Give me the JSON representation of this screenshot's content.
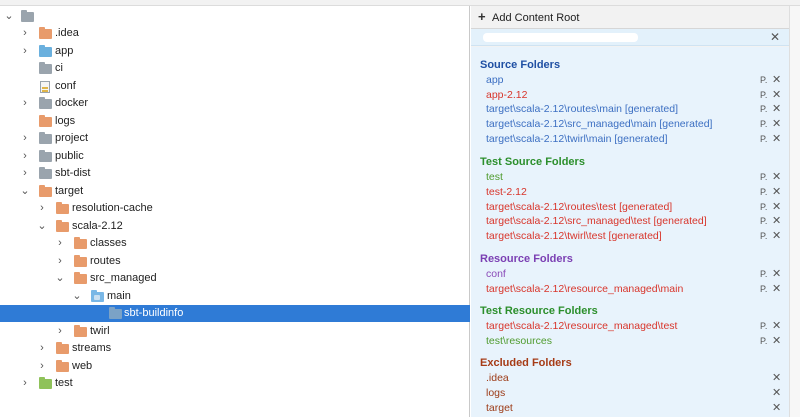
{
  "colors": {
    "selection": "#2f7bd6",
    "folder_orange": "#e89b6b",
    "source_blue": "#3c6fc2",
    "generated_red": "#d8352b",
    "test_green": "#4f9b2e",
    "resource_purple": "#8a4bb8",
    "excluded_brown": "#9c3a16"
  },
  "tree": {
    "rows": [
      {
        "label": "",
        "icon": "folder-grey-icon",
        "expand": "chevron-down-icon"
      },
      {
        "label": ".idea",
        "icon": "folder-orange-icon",
        "expand": "chevron-right-icon"
      },
      {
        "label": "app",
        "icon": "folder-blue-icon",
        "expand": "chevron-right-icon"
      },
      {
        "label": "ci",
        "icon": "folder-grey-icon",
        "expand": ""
      },
      {
        "label": "conf",
        "icon": "file-icon",
        "expand": ""
      },
      {
        "label": "docker",
        "icon": "folder-grey-icon",
        "expand": "chevron-right-icon"
      },
      {
        "label": "logs",
        "icon": "folder-orange-icon",
        "expand": ""
      },
      {
        "label": "project",
        "icon": "folder-grey-icon",
        "expand": "chevron-right-icon"
      },
      {
        "label": "public",
        "icon": "folder-grey-icon",
        "expand": "chevron-right-icon"
      },
      {
        "label": "sbt-dist",
        "icon": "folder-grey-icon",
        "expand": "chevron-right-icon"
      },
      {
        "label": "target",
        "icon": "folder-orange-icon",
        "expand": "chevron-down-icon"
      },
      {
        "label": "resolution-cache",
        "icon": "folder-orange-icon",
        "expand": "chevron-right-icon"
      },
      {
        "label": "scala-2.12",
        "icon": "folder-orange-icon",
        "expand": "chevron-down-icon"
      },
      {
        "label": "classes",
        "icon": "folder-orange-icon",
        "expand": "chevron-right-icon"
      },
      {
        "label": "routes",
        "icon": "folder-orange-icon",
        "expand": "chevron-right-icon"
      },
      {
        "label": "src_managed",
        "icon": "folder-orange-icon",
        "expand": "chevron-down-icon"
      },
      {
        "label": "main",
        "icon": "generated-source-folder-icon",
        "expand": "chevron-down-icon"
      },
      {
        "label": "sbt-buildinfo",
        "icon": "folder-icon",
        "expand": ""
      },
      {
        "label": "twirl",
        "icon": "folder-orange-icon",
        "expand": "chevron-right-icon"
      },
      {
        "label": "streams",
        "icon": "folder-orange-icon",
        "expand": "chevron-right-icon"
      },
      {
        "label": "web",
        "icon": "folder-orange-icon",
        "expand": "chevron-right-icon"
      },
      {
        "label": "test",
        "icon": "folder-green-icon",
        "expand": "chevron-right-icon"
      }
    ]
  },
  "panel": {
    "add_content_root": "Add Content Root",
    "add_icon": "plus-icon",
    "close_icon": "close-icon",
    "sections": {
      "source": {
        "title": "Source Folders",
        "entries": [
          "app",
          "app-2.12",
          "target\\scala-2.12\\routes\\main [generated]",
          "target\\scala-2.12\\src_managed\\main [generated]",
          "target\\scala-2.12\\twirl\\main [generated]"
        ]
      },
      "test_source": {
        "title": "Test Source Folders",
        "entries": [
          "test",
          "test-2.12",
          "target\\scala-2.12\\routes\\test [generated]",
          "target\\scala-2.12\\src_managed\\test [generated]",
          "target\\scala-2.12\\twirl\\test [generated]"
        ]
      },
      "resource": {
        "title": "Resource Folders",
        "entries": [
          "conf",
          "target\\scala-2.12\\resource_managed\\main"
        ]
      },
      "test_resource": {
        "title": "Test Resource Folders",
        "entries": [
          "target\\scala-2.12\\resource_managed\\test",
          "test\\resources"
        ]
      },
      "excluded": {
        "title": "Excluded Folders",
        "entries": [
          ".idea",
          "logs",
          "target"
        ]
      }
    },
    "properties_glyph": "P.",
    "remove_glyph": "✕"
  }
}
